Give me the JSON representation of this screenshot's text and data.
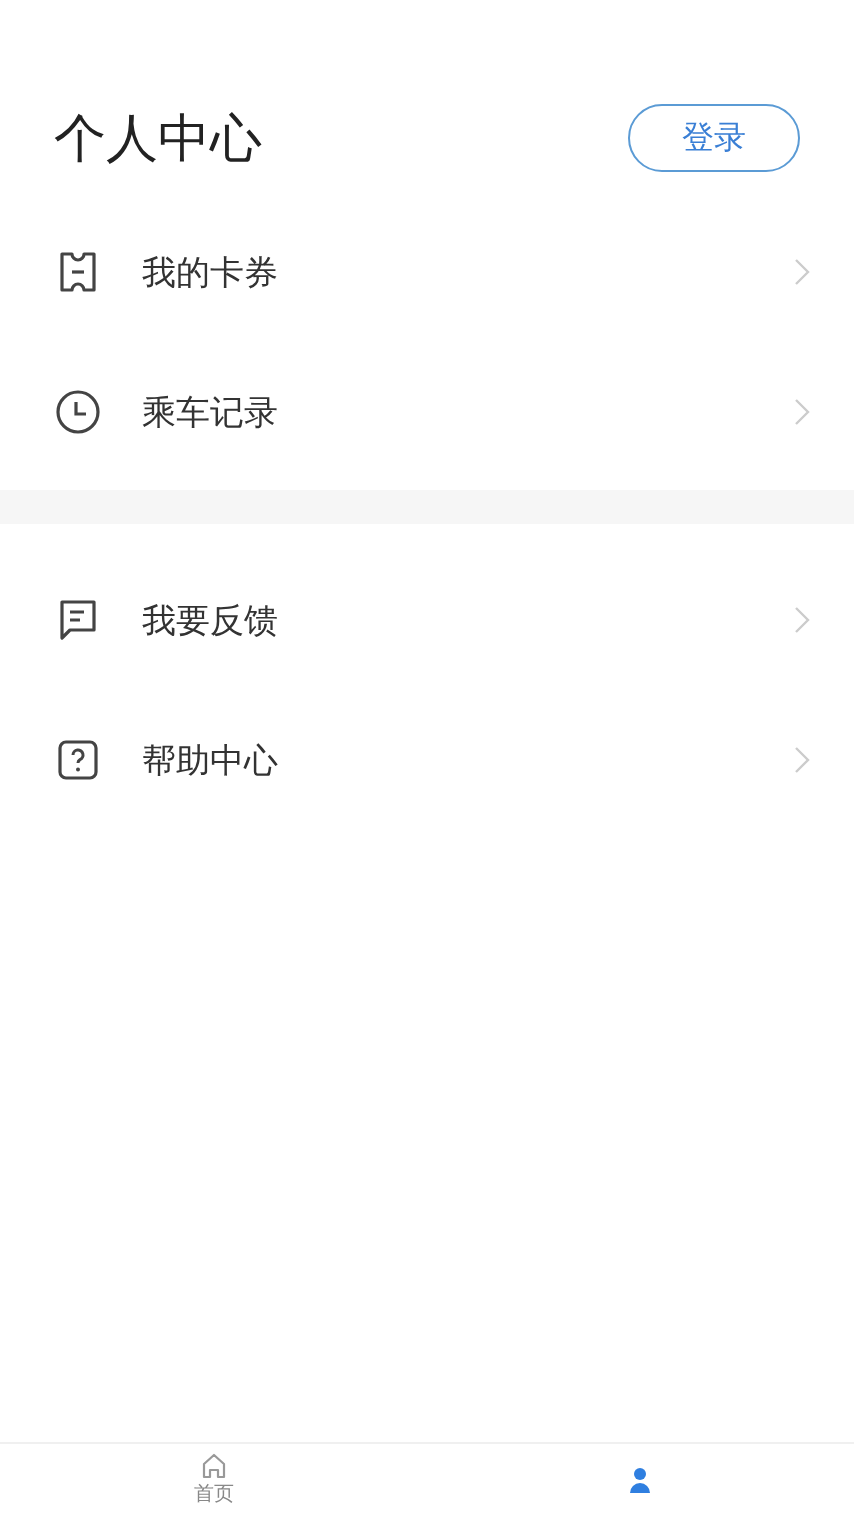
{
  "title": "个人中心",
  "login_button": "登录",
  "sections": [
    {
      "items": [
        {
          "kind": "ticket",
          "label": "我的卡券"
        },
        {
          "kind": "clock",
          "label": "乘车记录"
        }
      ]
    },
    {
      "items": [
        {
          "kind": "feedback",
          "label": "我要反馈"
        },
        {
          "kind": "help",
          "label": "帮助中心"
        }
      ]
    }
  ],
  "tab_bar": [
    {
      "kind": "home",
      "label": "首页",
      "selected": false
    },
    {
      "kind": "person",
      "selected": true
    }
  ]
}
